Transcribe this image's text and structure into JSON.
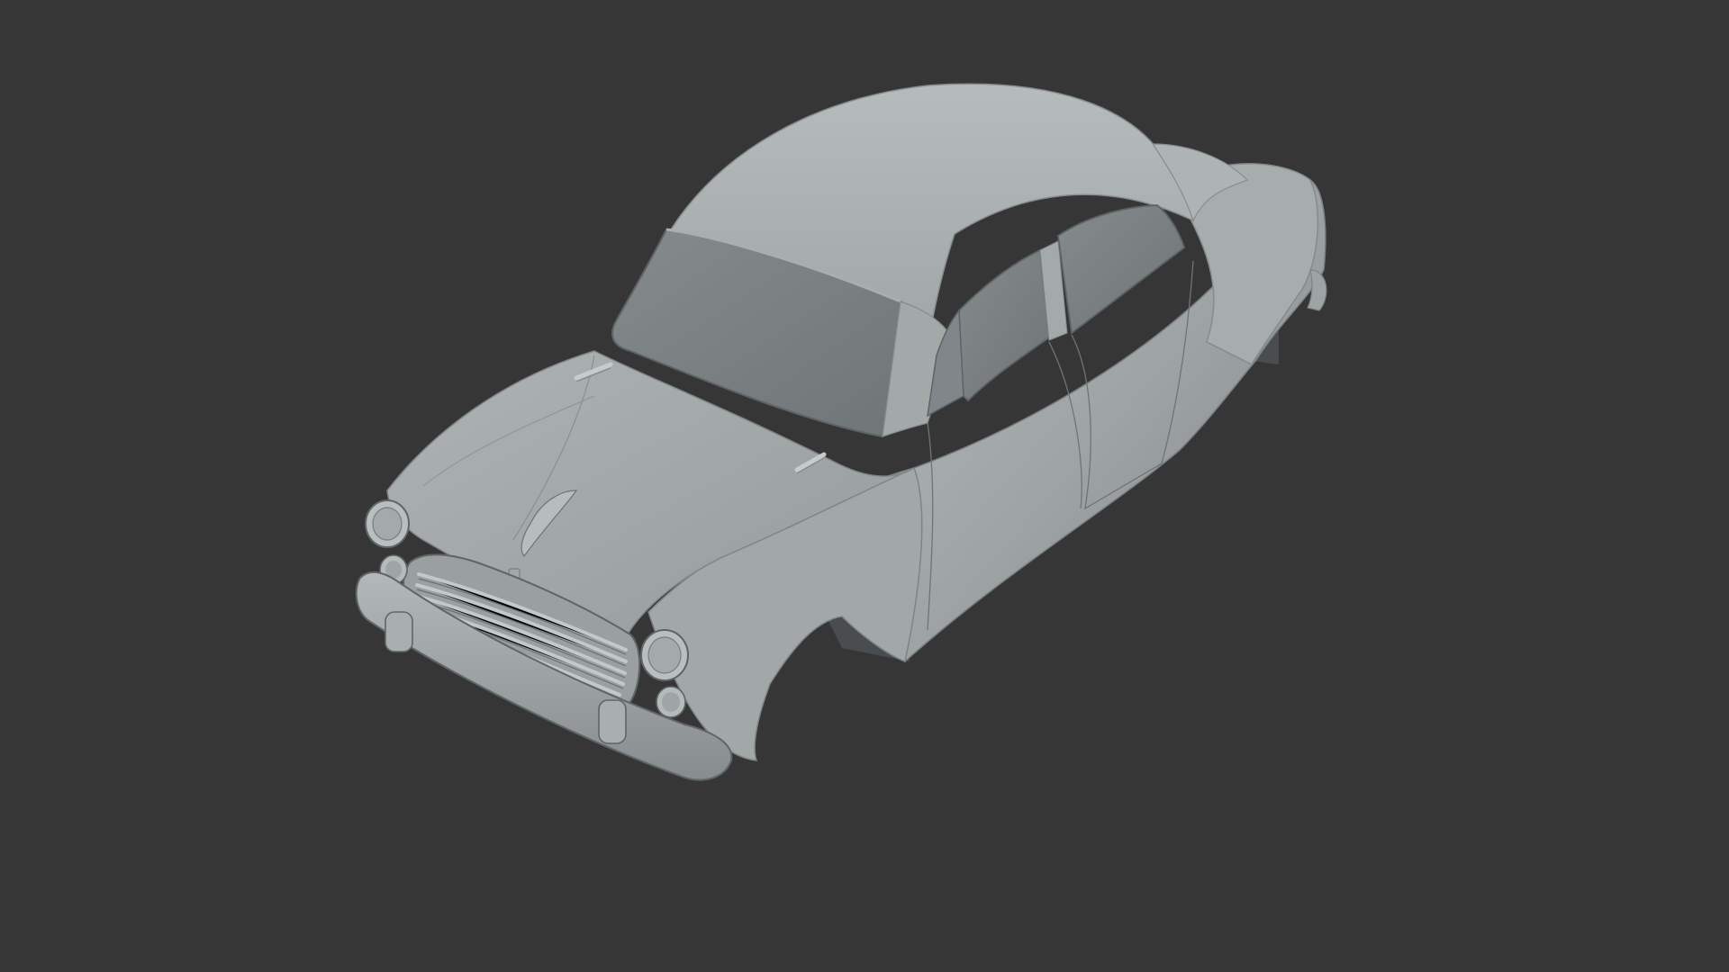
{
  "scene": {
    "background_color": "#363636",
    "model_base_color": "#9ea3a4",
    "model_highlight_color": "#c3c8c9",
    "model_shadow_color": "#5d6163",
    "glass_color": "#7a8082",
    "subject": "untextured-3d-car-body-model"
  }
}
